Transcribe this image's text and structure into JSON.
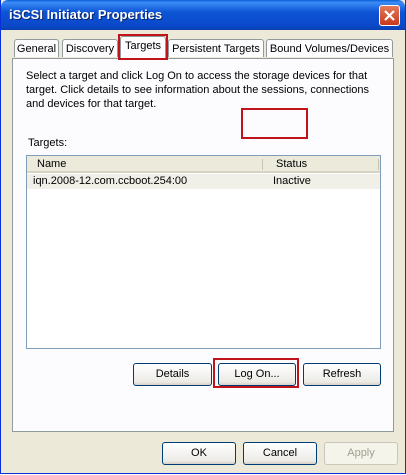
{
  "window": {
    "title": "iSCSI Initiator Properties"
  },
  "tabs": [
    {
      "label": "General"
    },
    {
      "label": "Discovery"
    },
    {
      "label": "Targets",
      "active": true
    },
    {
      "label": "Persistent Targets"
    },
    {
      "label": "Bound Volumes/Devices"
    }
  ],
  "targets_panel": {
    "description": "Select a target and click Log On to access the storage devices for that target. Click details to see information about the sessions, connections and devices for that target.",
    "list_label": "Targets:",
    "columns": {
      "name": "Name",
      "status": "Status"
    },
    "rows": [
      {
        "name": "iqn.2008-12.com.ccboot.254:00",
        "status": "Inactive"
      }
    ],
    "buttons": {
      "details": "Details",
      "logon": "Log On...",
      "refresh": "Refresh"
    }
  },
  "dialog_buttons": {
    "ok": "OK",
    "cancel": "Cancel",
    "apply": "Apply"
  },
  "colors": {
    "highlight": "#c0141a",
    "titlebar": "#0a48c8"
  }
}
